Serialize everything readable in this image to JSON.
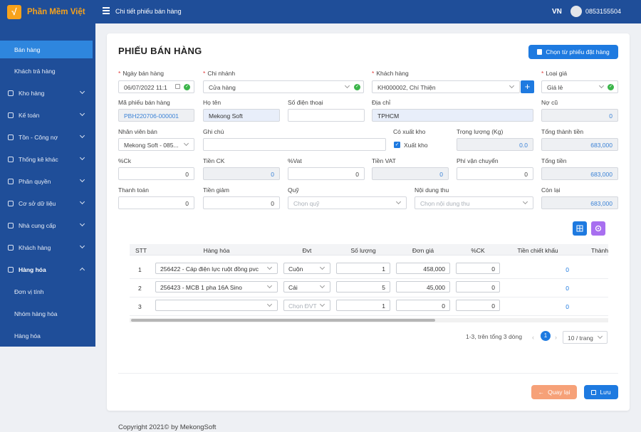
{
  "app": {
    "logo_mark": "√",
    "logo_text": "Phần Mềm Việt",
    "breadcrumb": "Chi tiết phiếu bán hàng",
    "lang": "VN",
    "phone": "0853155504"
  },
  "sidebar": {
    "items": [
      {
        "label": "Bán hàng"
      },
      {
        "label": "Khách trả hàng"
      },
      {
        "label": "Kho hàng"
      },
      {
        "label": "Kế toán"
      },
      {
        "label": "Tồn - Công nợ"
      },
      {
        "label": "Thống kê khác"
      },
      {
        "label": "Phân quyền"
      },
      {
        "label": "Cơ sở dữ liệu"
      },
      {
        "label": "Nhà cung cấp"
      },
      {
        "label": "Khách hàng"
      },
      {
        "label": "Hàng hóa"
      },
      {
        "label": "Đơn vị tính"
      },
      {
        "label": "Nhóm hàng hóa"
      },
      {
        "label": "Hàng hóa"
      }
    ]
  },
  "page": {
    "title": "PHIẾU BÁN HÀNG",
    "pick_order_btn": "Chọn từ phiếu đặt hàng"
  },
  "form": {
    "date": {
      "label": "Ngày bán hàng",
      "value": "06/07/2022 11:1"
    },
    "branch": {
      "label": "Chi nhánh",
      "value": "Cửa hàng"
    },
    "customer": {
      "label": "Khách hàng",
      "value": "KH000002, Chí Thiện"
    },
    "price_type": {
      "label": "Loại giá",
      "value": "Giá lẻ"
    },
    "code": {
      "label": "Mã phiếu bán hàng",
      "value": "PBH220706-000001"
    },
    "name": {
      "label": "Họ tên",
      "value": "Mekong Soft"
    },
    "phone": {
      "label": "Số điện thoại",
      "value": ""
    },
    "address": {
      "label": "Địa chỉ",
      "value": "TPHCM"
    },
    "old_debt": {
      "label": "Nợ cũ",
      "value": "0"
    },
    "staff": {
      "label": "Nhân viên bán",
      "value": "Mekong Soft - 085..."
    },
    "note": {
      "label": "Ghi chú",
      "value": ""
    },
    "export": {
      "label": "Có xuất kho",
      "check_label": "Xuất kho"
    },
    "weight": {
      "label": "Trọng lượng (Kg)",
      "value": "0.0"
    },
    "total_goods": {
      "label": "Tổng thành tiền",
      "value": "683,000"
    },
    "ck_pct": {
      "label": "%Ck",
      "value": "0"
    },
    "ck_amount": {
      "label": "Tiền CK",
      "value": "0"
    },
    "vat_pct": {
      "label": "%Vat",
      "value": "0"
    },
    "vat_amount": {
      "label": "Tiền VAT",
      "value": "0"
    },
    "shipping": {
      "label": "Phí vận chuyển",
      "value": "0"
    },
    "total": {
      "label": "Tổng tiền",
      "value": "683,000"
    },
    "payment": {
      "label": "Thanh toán",
      "value": "0"
    },
    "discount": {
      "label": "Tiền giảm",
      "value": "0"
    },
    "fund": {
      "label": "Quỹ",
      "placeholder": "Chọn quỹ"
    },
    "content": {
      "label": "Nội dung thu",
      "placeholder": "Chọn nội dung thu"
    },
    "remaining": {
      "label": "Còn lại",
      "value": "683,000"
    }
  },
  "table": {
    "headers": [
      "STT",
      "Hàng hóa",
      "Đvt",
      "Số lượng",
      "Đơn giá",
      "%CK",
      "Tiền chiết khấu",
      "Thành"
    ],
    "rows": [
      {
        "stt": "1",
        "product": "256422 - Cáp điện lực ruột đồng pvc",
        "unit": "Cuộn",
        "qty": "1",
        "price": "458,000",
        "ck": "0",
        "discount": "0"
      },
      {
        "stt": "2",
        "product": "256423 - MCB 1 pha 16A Sino",
        "unit": "Cái",
        "qty": "5",
        "price": "45,000",
        "ck": "0",
        "discount": "0"
      },
      {
        "stt": "3",
        "product": "",
        "unit": "Chọn ĐVT",
        "qty": "1",
        "price": "0",
        "ck": "0",
        "discount": "0"
      }
    ]
  },
  "pager": {
    "info": "1-3, trên tổng 3 dòng",
    "current": "1",
    "prev": "‹",
    "next": "›",
    "size": "10 / trang"
  },
  "actions": {
    "back": "Quay lại",
    "save": "Lưu"
  },
  "footer": "Copyright 2021© by MekongSoft",
  "colors": {
    "primary": "#1e7ae0",
    "sidebar": "#1f4e99",
    "accent": "#f7a21b",
    "back": "#f6a178",
    "purple": "#a86ff0"
  }
}
